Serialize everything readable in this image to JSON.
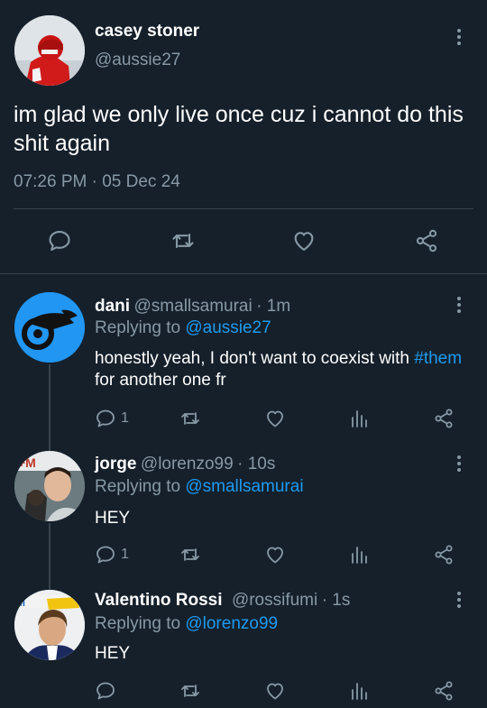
{
  "main_tweet": {
    "name": "casey stoner",
    "handle": "@aussie27",
    "text": "im glad we only live once cuz i cannot do this shit again",
    "timestamp": "07:26 PM · 05 Dec 24"
  },
  "replies": [
    {
      "name": "dani",
      "handle": "@smallsamurai",
      "time": "· 1m",
      "replying_prefix": "Replying to",
      "replying_to": "@aussie27",
      "text_before": "honestly yeah, I don't want to coexist with ",
      "hashtag": "#them",
      "text_after": " for another one fr",
      "reply_count": "1"
    },
    {
      "name": "jorge",
      "handle": "@lorenzo99",
      "time": "· 10s",
      "replying_prefix": "Replying to",
      "replying_to": "@smallsamurai",
      "text": "HEY",
      "reply_count": "1"
    },
    {
      "name": "Valentino Rossi",
      "handle": "@rossifumi",
      "time": "· 1s",
      "replying_prefix": "Replying to",
      "replying_to": "@lorenzo99",
      "text": "HEY"
    }
  ],
  "colors": {
    "background": "#15202b",
    "secondary_text": "#8899a6",
    "link": "#1d9bf0",
    "divider": "#38444d"
  },
  "icons": [
    "reply-icon",
    "retweet-icon",
    "like-icon",
    "share-icon",
    "analytics-icon",
    "more-icon"
  ]
}
